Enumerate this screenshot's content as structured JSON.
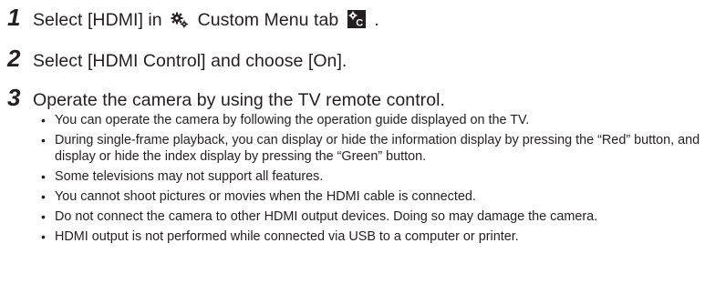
{
  "steps": [
    {
      "number": "1",
      "text_before": "Select [HDMI] in",
      "icon_custom_menu": "gear-custom-menu-icon",
      "text_middle": "Custom Menu tab",
      "icon_tab": "custom-menu-tab-c-icon",
      "tab_icon_letter": "C",
      "text_after": "."
    },
    {
      "number": "2",
      "text": "Select [HDMI Control] and choose [On]."
    },
    {
      "number": "3",
      "text": "Operate the camera by using the TV remote control."
    }
  ],
  "bullets": [
    "You can operate the camera by following the operation guide displayed on the TV.",
    "During single-frame playback, you can display or hide the information display by pressing the “Red” button, and display or hide the index display by pressing the “Green” button.",
    "Some televisions may not support all features.",
    "You cannot shoot pictures or movies when the HDMI cable is connected.",
    "Do not connect the camera to other HDMI output devices. Doing so may damage the camera.",
    "HDMI output is not performed while connected via USB to a computer or printer."
  ],
  "bullet_glyph": "•",
  "colors": {
    "text": "#231f20",
    "icon_fill": "#231f20"
  }
}
